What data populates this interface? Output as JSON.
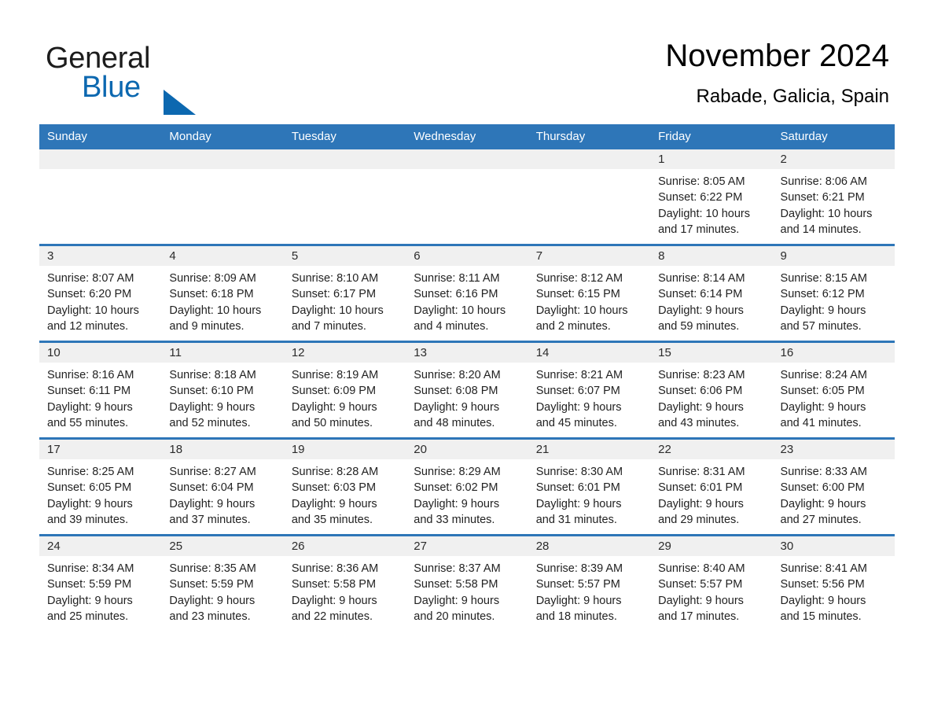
{
  "brand": {
    "name_part1": "General",
    "name_part2": "Blue",
    "accent_color": "#0c68b0"
  },
  "header": {
    "title": "November 2024",
    "subtitle": "Rabade, Galicia, Spain"
  },
  "theme": {
    "header_bar_color": "#2e76b8",
    "daynum_band_color": "#f0f0f0",
    "page_background": "#ffffff"
  },
  "calendar": {
    "weekday_headers": [
      "Sunday",
      "Monday",
      "Tuesday",
      "Wednesday",
      "Thursday",
      "Friday",
      "Saturday"
    ],
    "weeks": [
      [
        {
          "day": "",
          "empty": true
        },
        {
          "day": "",
          "empty": true
        },
        {
          "day": "",
          "empty": true
        },
        {
          "day": "",
          "empty": true
        },
        {
          "day": "",
          "empty": true
        },
        {
          "day": "1",
          "sunrise": "Sunrise: 8:05 AM",
          "sunset": "Sunset: 6:22 PM",
          "daylight": "Daylight: 10 hours and 17 minutes."
        },
        {
          "day": "2",
          "sunrise": "Sunrise: 8:06 AM",
          "sunset": "Sunset: 6:21 PM",
          "daylight": "Daylight: 10 hours and 14 minutes."
        }
      ],
      [
        {
          "day": "3",
          "sunrise": "Sunrise: 8:07 AM",
          "sunset": "Sunset: 6:20 PM",
          "daylight": "Daylight: 10 hours and 12 minutes."
        },
        {
          "day": "4",
          "sunrise": "Sunrise: 8:09 AM",
          "sunset": "Sunset: 6:18 PM",
          "daylight": "Daylight: 10 hours and 9 minutes."
        },
        {
          "day": "5",
          "sunrise": "Sunrise: 8:10 AM",
          "sunset": "Sunset: 6:17 PM",
          "daylight": "Daylight: 10 hours and 7 minutes."
        },
        {
          "day": "6",
          "sunrise": "Sunrise: 8:11 AM",
          "sunset": "Sunset: 6:16 PM",
          "daylight": "Daylight: 10 hours and 4 minutes."
        },
        {
          "day": "7",
          "sunrise": "Sunrise: 8:12 AM",
          "sunset": "Sunset: 6:15 PM",
          "daylight": "Daylight: 10 hours and 2 minutes."
        },
        {
          "day": "8",
          "sunrise": "Sunrise: 8:14 AM",
          "sunset": "Sunset: 6:14 PM",
          "daylight": "Daylight: 9 hours and 59 minutes."
        },
        {
          "day": "9",
          "sunrise": "Sunrise: 8:15 AM",
          "sunset": "Sunset: 6:12 PM",
          "daylight": "Daylight: 9 hours and 57 minutes."
        }
      ],
      [
        {
          "day": "10",
          "sunrise": "Sunrise: 8:16 AM",
          "sunset": "Sunset: 6:11 PM",
          "daylight": "Daylight: 9 hours and 55 minutes."
        },
        {
          "day": "11",
          "sunrise": "Sunrise: 8:18 AM",
          "sunset": "Sunset: 6:10 PM",
          "daylight": "Daylight: 9 hours and 52 minutes."
        },
        {
          "day": "12",
          "sunrise": "Sunrise: 8:19 AM",
          "sunset": "Sunset: 6:09 PM",
          "daylight": "Daylight: 9 hours and 50 minutes."
        },
        {
          "day": "13",
          "sunrise": "Sunrise: 8:20 AM",
          "sunset": "Sunset: 6:08 PM",
          "daylight": "Daylight: 9 hours and 48 minutes."
        },
        {
          "day": "14",
          "sunrise": "Sunrise: 8:21 AM",
          "sunset": "Sunset: 6:07 PM",
          "daylight": "Daylight: 9 hours and 45 minutes."
        },
        {
          "day": "15",
          "sunrise": "Sunrise: 8:23 AM",
          "sunset": "Sunset: 6:06 PM",
          "daylight": "Daylight: 9 hours and 43 minutes."
        },
        {
          "day": "16",
          "sunrise": "Sunrise: 8:24 AM",
          "sunset": "Sunset: 6:05 PM",
          "daylight": "Daylight: 9 hours and 41 minutes."
        }
      ],
      [
        {
          "day": "17",
          "sunrise": "Sunrise: 8:25 AM",
          "sunset": "Sunset: 6:05 PM",
          "daylight": "Daylight: 9 hours and 39 minutes."
        },
        {
          "day": "18",
          "sunrise": "Sunrise: 8:27 AM",
          "sunset": "Sunset: 6:04 PM",
          "daylight": "Daylight: 9 hours and 37 minutes."
        },
        {
          "day": "19",
          "sunrise": "Sunrise: 8:28 AM",
          "sunset": "Sunset: 6:03 PM",
          "daylight": "Daylight: 9 hours and 35 minutes."
        },
        {
          "day": "20",
          "sunrise": "Sunrise: 8:29 AM",
          "sunset": "Sunset: 6:02 PM",
          "daylight": "Daylight: 9 hours and 33 minutes."
        },
        {
          "day": "21",
          "sunrise": "Sunrise: 8:30 AM",
          "sunset": "Sunset: 6:01 PM",
          "daylight": "Daylight: 9 hours and 31 minutes."
        },
        {
          "day": "22",
          "sunrise": "Sunrise: 8:31 AM",
          "sunset": "Sunset: 6:01 PM",
          "daylight": "Daylight: 9 hours and 29 minutes."
        },
        {
          "day": "23",
          "sunrise": "Sunrise: 8:33 AM",
          "sunset": "Sunset: 6:00 PM",
          "daylight": "Daylight: 9 hours and 27 minutes."
        }
      ],
      [
        {
          "day": "24",
          "sunrise": "Sunrise: 8:34 AM",
          "sunset": "Sunset: 5:59 PM",
          "daylight": "Daylight: 9 hours and 25 minutes."
        },
        {
          "day": "25",
          "sunrise": "Sunrise: 8:35 AM",
          "sunset": "Sunset: 5:59 PM",
          "daylight": "Daylight: 9 hours and 23 minutes."
        },
        {
          "day": "26",
          "sunrise": "Sunrise: 8:36 AM",
          "sunset": "Sunset: 5:58 PM",
          "daylight": "Daylight: 9 hours and 22 minutes."
        },
        {
          "day": "27",
          "sunrise": "Sunrise: 8:37 AM",
          "sunset": "Sunset: 5:58 PM",
          "daylight": "Daylight: 9 hours and 20 minutes."
        },
        {
          "day": "28",
          "sunrise": "Sunrise: 8:39 AM",
          "sunset": "Sunset: 5:57 PM",
          "daylight": "Daylight: 9 hours and 18 minutes."
        },
        {
          "day": "29",
          "sunrise": "Sunrise: 8:40 AM",
          "sunset": "Sunset: 5:57 PM",
          "daylight": "Daylight: 9 hours and 17 minutes."
        },
        {
          "day": "30",
          "sunrise": "Sunrise: 8:41 AM",
          "sunset": "Sunset: 5:56 PM",
          "daylight": "Daylight: 9 hours and 15 minutes."
        }
      ]
    ]
  }
}
